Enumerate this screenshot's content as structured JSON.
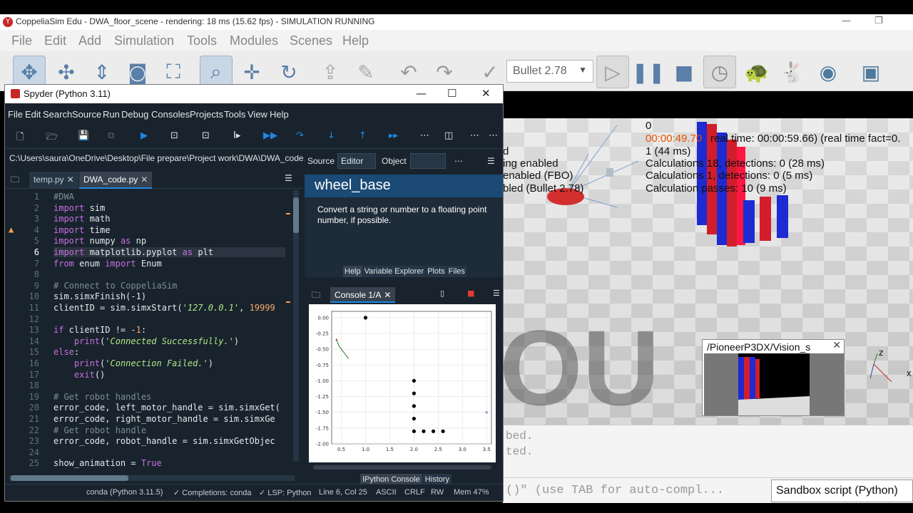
{
  "coppelia": {
    "title": "CoppeliaSim Edu - DWA_floor_scene - rendering: 18 ms (15.62 fps) - SIMULATION RUNNING",
    "menu": [
      "File",
      "Edit",
      "Add",
      "Simulation",
      "Tools",
      "Modules",
      "Scenes",
      "Help"
    ],
    "physics_engine": "Bullet 2.78",
    "overlay_lines": [
      {
        "text": "0",
        "color": "normal"
      },
      {
        "text": "00:00:49.70",
        "color": "red"
      },
      {
        "text": "real time: 00:00:59.66) (real time fact=0.",
        "color": "normal"
      },
      {
        "text": "1 (44 ms)",
        "color": "normal"
      },
      {
        "text": "Calculations 18, detections: 0 (28 ms)",
        "color": "normal"
      },
      {
        "text": "Calculations 1, detections: 0 (5 ms)",
        "color": "normal"
      },
      {
        "text": "Calculation passes: 10 (9 ms)",
        "color": "normal"
      }
    ],
    "left_overlay": [
      "d",
      "ing enabled",
      "enabled (FBO)",
      "bled (Bullet 2.78)"
    ],
    "vision_title": "/PioneerP3DX/Vision_s",
    "console_lines": [
      "bed.",
      "ted."
    ],
    "command_hint": "()\"  (use TAB for auto-compl...",
    "script_selector": "Sandbox script (Python)",
    "axis_label": "z"
  },
  "spyder": {
    "title": "Spyder (Python 3.11)",
    "menu": [
      "File",
      "Edit",
      "Search",
      "Source",
      "Run",
      "Debug",
      "Consoles",
      "Projects",
      "Tools",
      "View",
      "Help"
    ],
    "path": "C:\\Users\\saura\\OneDrive\\Desktop\\File prepare\\Project work\\DWA\\DWA_code.py",
    "tabs": [
      "temp.py",
      "DWA_code.py"
    ],
    "code_lines": [
      {
        "n": "1",
        "html": "<span class='cm'>#DWA</span>"
      },
      {
        "n": "2",
        "html": "<span class='kw'>import</span> sim"
      },
      {
        "n": "3",
        "html": "<span class='kw'>import</span> math"
      },
      {
        "n": "4",
        "html": "<span class='kw'>import</span> time"
      },
      {
        "n": "5",
        "html": "<span class='kw'>import</span> numpy <span class='kw'>as</span> np"
      },
      {
        "n": "6",
        "html": "<span class='kw'>import</span> matplotlib.pyplot <span class='kw'>as</span> plt"
      },
      {
        "n": "7",
        "html": "<span class='kw'>from</span> enum <span class='kw'>import</span> Enum"
      },
      {
        "n": "8",
        "html": ""
      },
      {
        "n": "9",
        "html": "<span class='cm'># Connect to CoppeliaSim</span>"
      },
      {
        "n": "10",
        "html": "sim.simxFinish(-1)"
      },
      {
        "n": "11",
        "html": "clientID = sim.simxStart(<span class='st'>'127.0.0.1'</span>, <span class='nm'>19999</span>"
      },
      {
        "n": "12",
        "html": ""
      },
      {
        "n": "13",
        "html": "<span class='kw'>if</span> clientID != -<span class='nm'>1</span>:"
      },
      {
        "n": "14",
        "html": "    <span class='kw'>print</span>(<span class='st'>'Connected Successfully.'</span>)"
      },
      {
        "n": "15",
        "html": "<span class='kw'>else</span>:"
      },
      {
        "n": "16",
        "html": "    <span class='kw'>print</span>(<span class='st'>'Connection Failed.'</span>)"
      },
      {
        "n": "17",
        "html": "    <span class='kw'>exit</span>()"
      },
      {
        "n": "18",
        "html": ""
      },
      {
        "n": "19",
        "html": "<span class='cm'># Get robot handles</span>"
      },
      {
        "n": "20",
        "html": "error_code, left_motor_handle = sim.simxGet("
      },
      {
        "n": "21",
        "html": "error_code, right_motor_handle = sim.simxGe"
      },
      {
        "n": "22",
        "html": "<span class='cm'># Get robot handle</span>"
      },
      {
        "n": "23",
        "html": "error_code, robot_handle = sim.simxGetObjec"
      },
      {
        "n": "24",
        "html": ""
      },
      {
        "n": "25",
        "html": "show_animation = <span class='kw'>True</span>"
      }
    ],
    "help": {
      "source_label": "Source",
      "editor_option": "Editor",
      "object_label": "Object",
      "heading": "wheel_base",
      "body": "Convert a string or number to a floating point number, if possible.",
      "tabs": [
        "Help",
        "Variable Explorer",
        "Plots",
        "Files"
      ]
    },
    "console": {
      "tab": "Console 1/A",
      "tabs": [
        "IPython Console",
        "History"
      ]
    },
    "status": {
      "env": "conda (Python 3.11.5)",
      "completions": "✓ Completions: conda",
      "lsp": "✓ LSP: Python",
      "cursor": "Line 6, Col 25",
      "encoding": "ASCII",
      "eol": "CRLF",
      "rw": "RW",
      "mem": "Mem 47%"
    }
  },
  "chart_data": [
    {
      "type": "scatter",
      "xlim": [
        0.3,
        3.6
      ],
      "ylim": [
        -2.0,
        0.1
      ],
      "x_ticks": [
        "0.5",
        "1.0",
        "1.5",
        "2.0",
        "2.5",
        "3.0",
        "3.5"
      ],
      "y_ticks": [
        "0.00",
        "-0.25",
        "-0.50",
        "-0.75",
        "-1.00",
        "-1.25",
        "-1.50",
        "-1.75",
        "-2.00"
      ],
      "grid": true,
      "series": [
        {
          "points": [
            [
              1.0,
              0.0
            ],
            [
              2.0,
              -1.0
            ],
            [
              2.0,
              -1.2
            ],
            [
              2.0,
              -1.4
            ],
            [
              2.0,
              -1.6
            ],
            [
              2.0,
              -1.8
            ],
            [
              2.2,
              -1.8
            ],
            [
              2.4,
              -1.8
            ],
            [
              2.6,
              -1.8
            ]
          ],
          "color": "#000000"
        },
        {
          "points": [
            [
              0.4,
              -0.35
            ],
            [
              0.45,
              -0.45
            ],
            [
              0.55,
              -0.55
            ],
            [
              0.65,
              -0.65
            ]
          ],
          "color": "#2e7d32"
        },
        {
          "points": [
            [
              3.5,
              -1.5
            ]
          ],
          "color": "#3949ab"
        }
      ]
    }
  ]
}
